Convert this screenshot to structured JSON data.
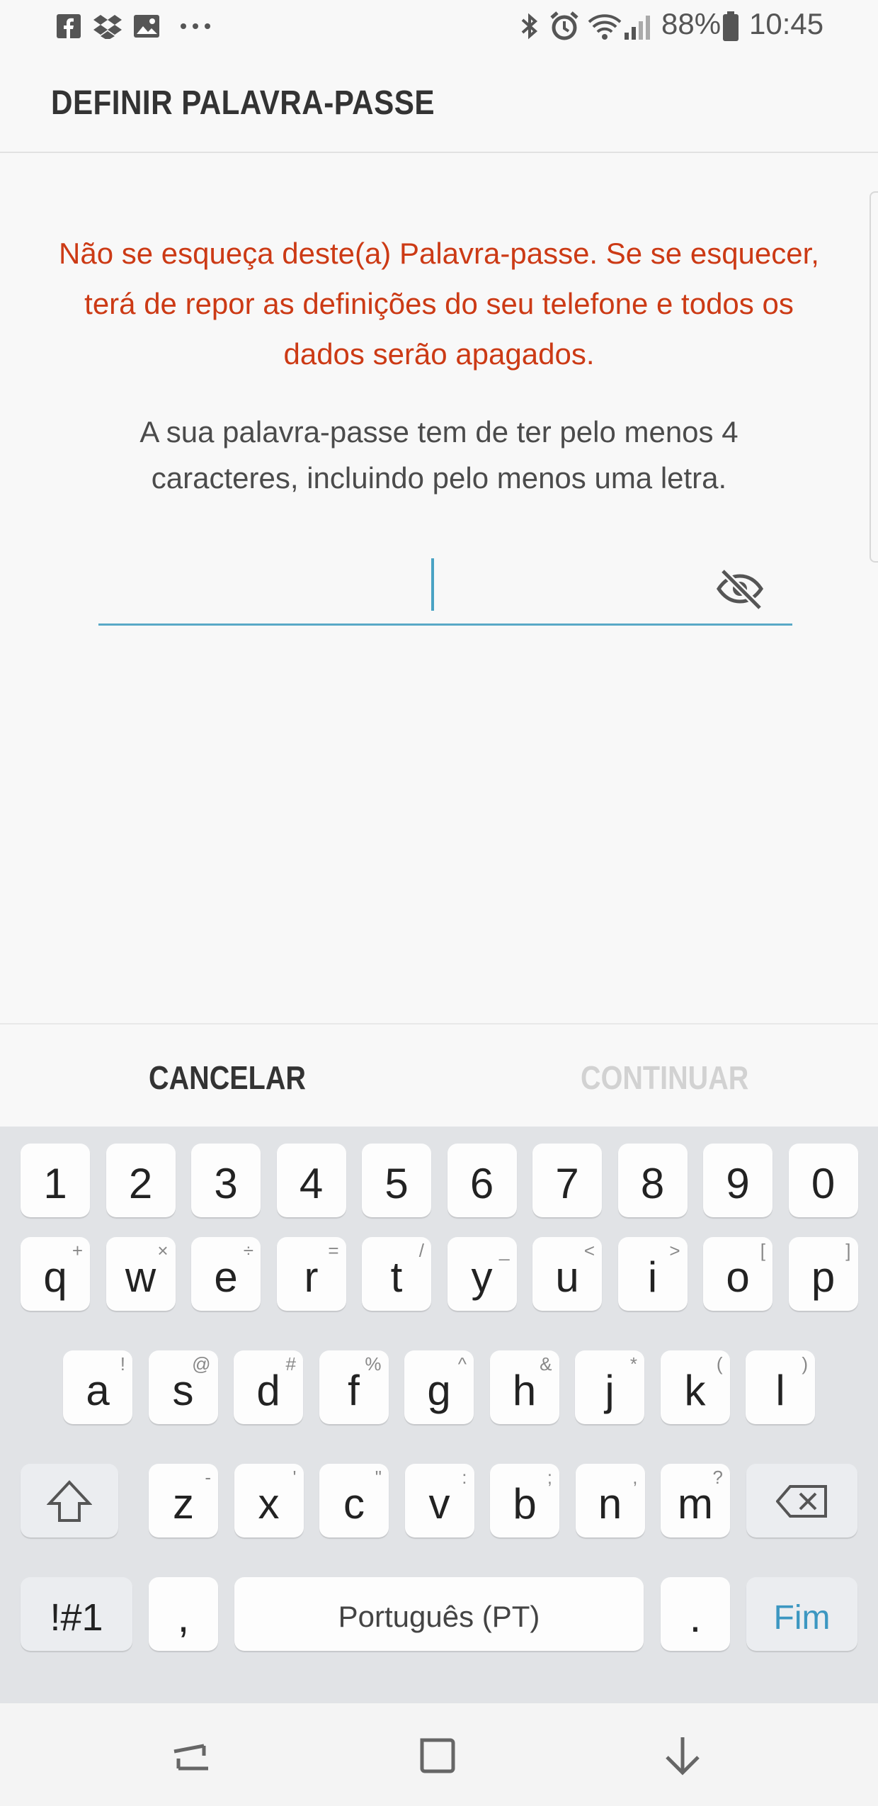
{
  "status_bar": {
    "left_icons": [
      "facebook-icon",
      "dropbox-icon",
      "gallery-icon",
      "more-dots-icon"
    ],
    "right_icons": [
      "bluetooth-icon",
      "alarm-icon",
      "wifi-icon",
      "signal-icon",
      "battery-icon"
    ],
    "battery": "88%",
    "time": "10:45"
  },
  "header": {
    "title": "DEFINIR PALAVRA-PASSE"
  },
  "warning_text": "Não se esqueça deste(a) Palavra-passe. Se se esquecer, terá de repor as definições do seu telefone e todos os dados serão apagados.",
  "info_text": "A sua palavra-passe tem de ter pelo menos 4 caracteres, incluindo pelo menos uma letra.",
  "password_field": {
    "value": "",
    "toggle_icon": "eye-off-icon"
  },
  "buttons": {
    "cancel": "CANCELAR",
    "continue": "CONTINUAR"
  },
  "keyboard": {
    "numbers": [
      "1",
      "2",
      "3",
      "4",
      "5",
      "6",
      "7",
      "8",
      "9",
      "0"
    ],
    "row1": [
      {
        "k": "q",
        "s": "+"
      },
      {
        "k": "w",
        "s": "×"
      },
      {
        "k": "e",
        "s": "÷"
      },
      {
        "k": "r",
        "s": "="
      },
      {
        "k": "t",
        "s": "/"
      },
      {
        "k": "y",
        "s": "_"
      },
      {
        "k": "u",
        "s": "<"
      },
      {
        "k": "i",
        "s": ">"
      },
      {
        "k": "o",
        "s": "["
      },
      {
        "k": "p",
        "s": "]"
      }
    ],
    "row2": [
      {
        "k": "a",
        "s": "!"
      },
      {
        "k": "s",
        "s": "@"
      },
      {
        "k": "d",
        "s": "#"
      },
      {
        "k": "f",
        "s": "%"
      },
      {
        "k": "g",
        "s": "^"
      },
      {
        "k": "h",
        "s": "&"
      },
      {
        "k": "j",
        "s": "*"
      },
      {
        "k": "k",
        "s": "("
      },
      {
        "k": "l",
        "s": ")"
      }
    ],
    "row3": [
      {
        "k": "z",
        "s": "-"
      },
      {
        "k": "x",
        "s": "'"
      },
      {
        "k": "c",
        "s": "\""
      },
      {
        "k": "v",
        "s": ":"
      },
      {
        "k": "b",
        "s": ";"
      },
      {
        "k": "n",
        "s": ","
      },
      {
        "k": "m",
        "s": "?"
      }
    ],
    "symbols_label": "!#1",
    "comma": ",",
    "space_label": "Português (PT)",
    "period": ".",
    "done_label": "Fim",
    "done_color": "#3c97c1"
  },
  "nav_bar": {
    "icons": [
      "recents-icon",
      "home-icon",
      "back-icon"
    ]
  }
}
